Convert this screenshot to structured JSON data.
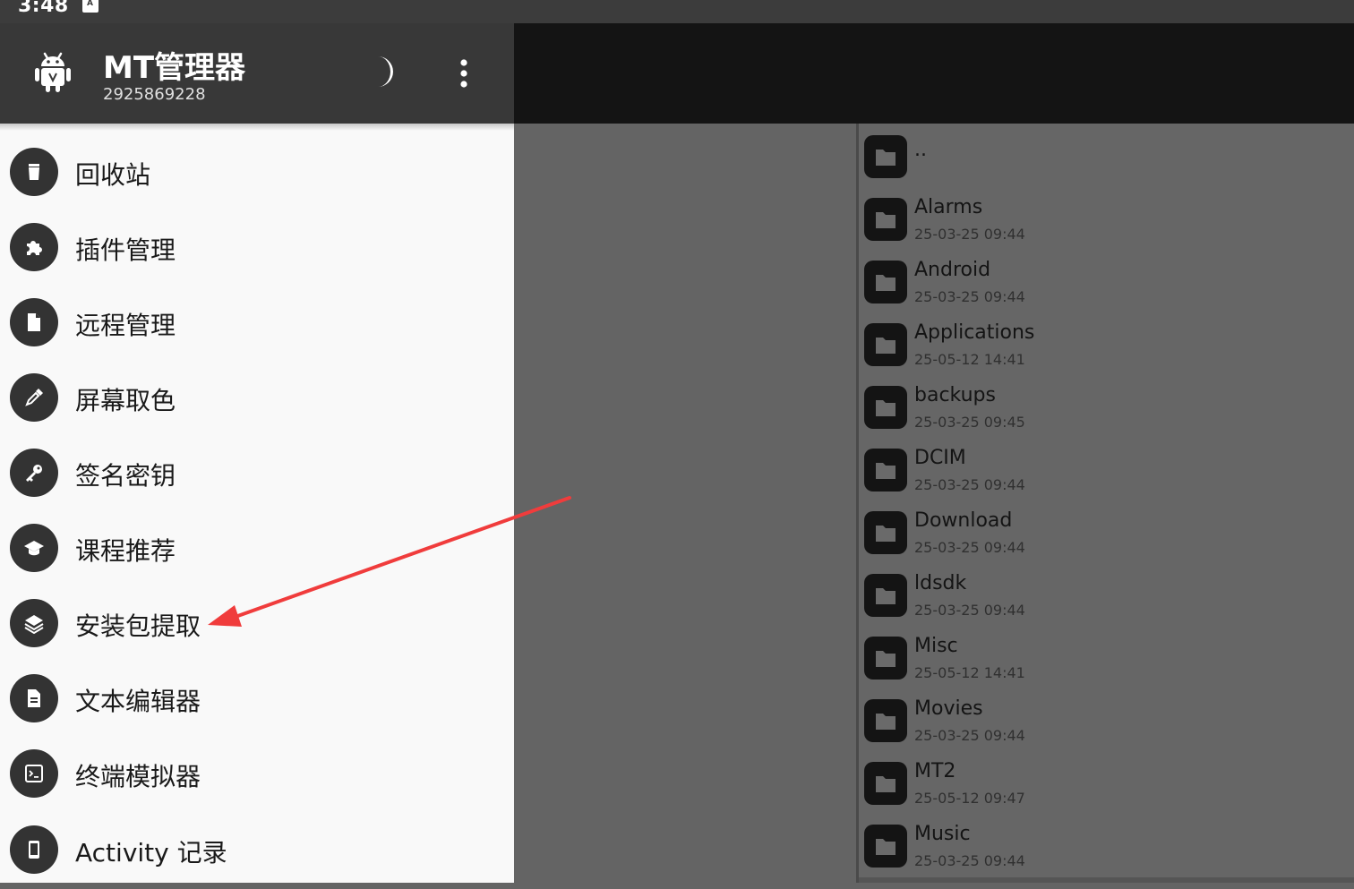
{
  "status_bar": {
    "time": "3:48",
    "icon": "a-notification-icon",
    "icon_letter": "A"
  },
  "header": {
    "title": "MT管理器",
    "subtitle": "2925869228",
    "logo_icon": "android-icon",
    "theme_icon": "moon-icon",
    "menu_icon": "more-vert-icon"
  },
  "menu": {
    "items": [
      {
        "label": "回收站",
        "icon": "trash-icon"
      },
      {
        "label": "插件管理",
        "icon": "puzzle-icon"
      },
      {
        "label": "远程管理",
        "icon": "file-icon"
      },
      {
        "label": "屏幕取色",
        "icon": "eyedropper-icon"
      },
      {
        "label": "签名密钥",
        "icon": "key-icon"
      },
      {
        "label": "课程推荐",
        "icon": "graduation-cap-icon"
      },
      {
        "label": "安装包提取",
        "icon": "layers-icon"
      },
      {
        "label": "文本编辑器",
        "icon": "document-icon"
      },
      {
        "label": "终端模拟器",
        "icon": "terminal-icon"
      },
      {
        "label": "Activity 记录",
        "icon": "phone-icon"
      }
    ]
  },
  "files": {
    "parent": {
      "name": ".."
    },
    "items": [
      {
        "name": "Alarms",
        "date": "25-03-25 09:44"
      },
      {
        "name": "Android",
        "date": "25-03-25 09:44"
      },
      {
        "name": "Applications",
        "date": "25-05-12 14:41"
      },
      {
        "name": "backups",
        "date": "25-03-25 09:45"
      },
      {
        "name": "DCIM",
        "date": "25-03-25 09:44"
      },
      {
        "name": "Download",
        "date": "25-03-25 09:44"
      },
      {
        "name": "ldsdk",
        "date": "25-03-25 09:44"
      },
      {
        "name": "Misc",
        "date": "25-05-12 14:41"
      },
      {
        "name": "Movies",
        "date": "25-03-25 09:44"
      },
      {
        "name": "MT2",
        "date": "25-05-12 09:47"
      },
      {
        "name": "Music",
        "date": "25-03-25 09:44"
      }
    ]
  },
  "colors": {
    "header_bg": "#383838",
    "drawer_bg": "#f9f9f9",
    "icon_circle": "#333333",
    "scrim": "#646464",
    "annotation_arrow": "#f03c3c"
  }
}
